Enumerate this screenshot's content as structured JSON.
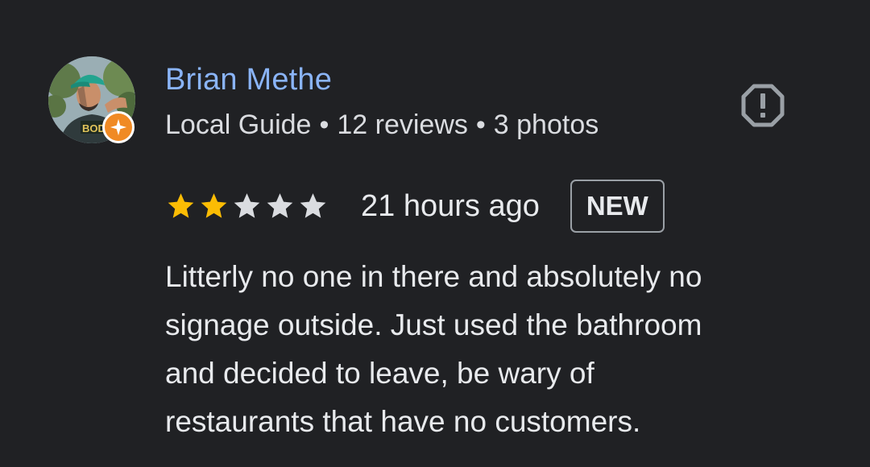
{
  "reviewer": {
    "name": "Brian Methe",
    "level": "Local Guide",
    "reviews": "12 reviews",
    "photos": "3 photos",
    "separator": "•",
    "avatar_shirt_text": "BOD"
  },
  "rating": {
    "filled": 2,
    "total": 5,
    "filled_color": "#fbbc04",
    "empty_color": "#dadce0"
  },
  "review": {
    "time": "21 hours ago",
    "badge": "NEW",
    "text": "Litterly no one in there and absolutely no\nsignage outside. Just used the bathroom\nand decided to leave, be wary of\nrestaurants that have no customers."
  },
  "icons": {
    "report": "report-icon",
    "guide_badge": "local-guide-star-icon"
  },
  "colors": {
    "background": "#202124",
    "name": "#8ab4f8",
    "guide_badge": "#f08a24"
  }
}
